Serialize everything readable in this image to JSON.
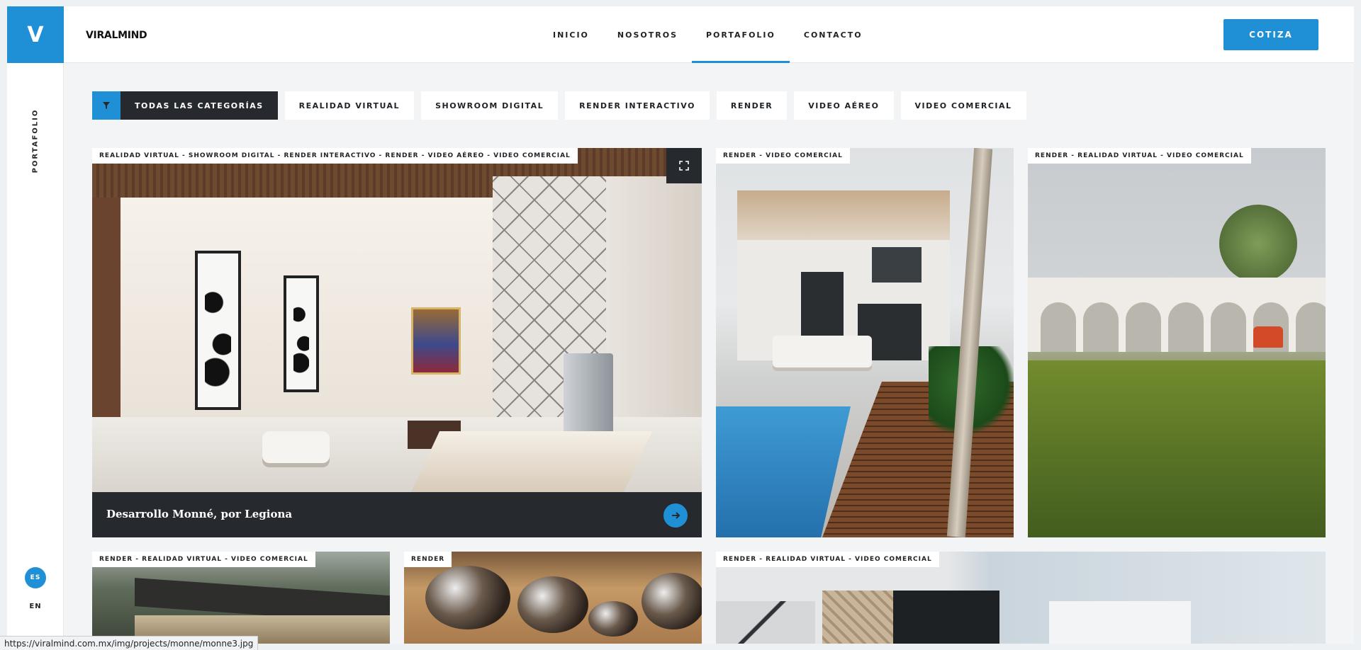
{
  "header": {
    "logo_letter": "V",
    "brand": "VIRALMIND",
    "nav": [
      {
        "label": "INICIO",
        "active": false
      },
      {
        "label": "NOSOTROS",
        "active": false
      },
      {
        "label": "PORTAFOLIO",
        "active": true
      },
      {
        "label": "CONTACTO",
        "active": false
      }
    ],
    "cta_label": "COTIZA"
  },
  "sidebar": {
    "section_label": "PORTAFOLIO",
    "languages": [
      {
        "code": "ES",
        "active": true
      },
      {
        "code": "EN",
        "active": false
      }
    ]
  },
  "filters": {
    "icon": "filter-icon",
    "all_label": "TODAS LAS CATEGORÍAS",
    "items": [
      "REALIDAD VIRTUAL",
      "SHOWROOM DIGITAL",
      "RENDER INTERACTIVO",
      "RENDER",
      "VIDEO AÉREO",
      "VIDEO COMERCIAL"
    ]
  },
  "projects": [
    {
      "tags": "REALIDAD VIRTUAL - SHOWROOM DIGITAL - RENDER INTERACTIVO - RENDER - VIDEO AÉREO - VIDEO COMERCIAL",
      "title": "Desarrollo Monné, por Legiona"
    },
    {
      "tags": "RENDER - VIDEO COMERCIAL"
    },
    {
      "tags": "RENDER - REALIDAD VIRTUAL - VIDEO COMERCIAL"
    },
    {
      "tags": "RENDER - REALIDAD VIRTUAL - VIDEO COMERCIAL"
    },
    {
      "tags": "RENDER"
    },
    {
      "tags": "RENDER - REALIDAD VIRTUAL - VIDEO COMERCIAL"
    }
  ],
  "status_bar": {
    "url": "https://viralmind.com.mx/img/projects/monne/monne3.jpg"
  },
  "colors": {
    "accent": "#1f8fd6",
    "dark": "#262a2f",
    "background": "#f2f4f6"
  }
}
